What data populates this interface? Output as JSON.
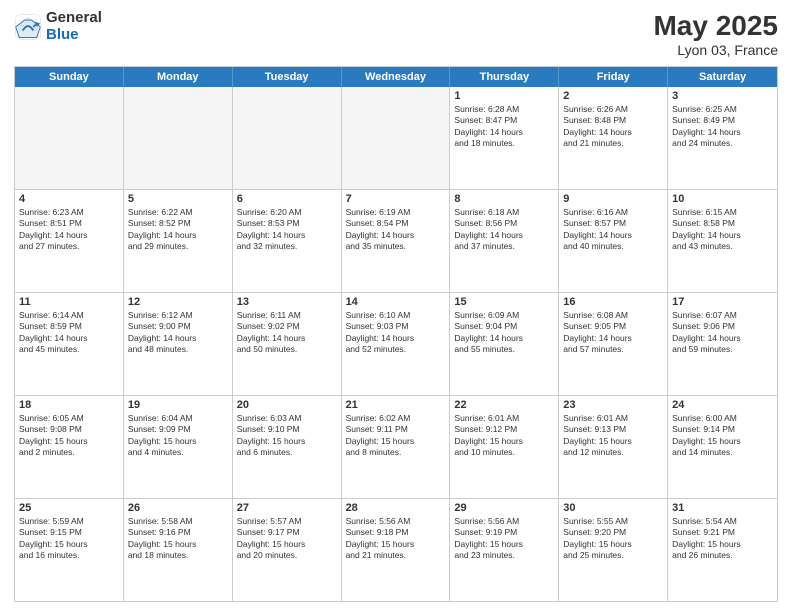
{
  "header": {
    "logo_general": "General",
    "logo_blue": "Blue",
    "title": "May 2025",
    "location": "Lyon 03, France"
  },
  "weekdays": [
    "Sunday",
    "Monday",
    "Tuesday",
    "Wednesday",
    "Thursday",
    "Friday",
    "Saturday"
  ],
  "rows": [
    [
      {
        "day": "",
        "info": ""
      },
      {
        "day": "",
        "info": ""
      },
      {
        "day": "",
        "info": ""
      },
      {
        "day": "",
        "info": ""
      },
      {
        "day": "1",
        "info": "Sunrise: 6:28 AM\nSunset: 8:47 PM\nDaylight: 14 hours\nand 18 minutes."
      },
      {
        "day": "2",
        "info": "Sunrise: 6:26 AM\nSunset: 8:48 PM\nDaylight: 14 hours\nand 21 minutes."
      },
      {
        "day": "3",
        "info": "Sunrise: 6:25 AM\nSunset: 8:49 PM\nDaylight: 14 hours\nand 24 minutes."
      }
    ],
    [
      {
        "day": "4",
        "info": "Sunrise: 6:23 AM\nSunset: 8:51 PM\nDaylight: 14 hours\nand 27 minutes."
      },
      {
        "day": "5",
        "info": "Sunrise: 6:22 AM\nSunset: 8:52 PM\nDaylight: 14 hours\nand 29 minutes."
      },
      {
        "day": "6",
        "info": "Sunrise: 6:20 AM\nSunset: 8:53 PM\nDaylight: 14 hours\nand 32 minutes."
      },
      {
        "day": "7",
        "info": "Sunrise: 6:19 AM\nSunset: 8:54 PM\nDaylight: 14 hours\nand 35 minutes."
      },
      {
        "day": "8",
        "info": "Sunrise: 6:18 AM\nSunset: 8:56 PM\nDaylight: 14 hours\nand 37 minutes."
      },
      {
        "day": "9",
        "info": "Sunrise: 6:16 AM\nSunset: 8:57 PM\nDaylight: 14 hours\nand 40 minutes."
      },
      {
        "day": "10",
        "info": "Sunrise: 6:15 AM\nSunset: 8:58 PM\nDaylight: 14 hours\nand 43 minutes."
      }
    ],
    [
      {
        "day": "11",
        "info": "Sunrise: 6:14 AM\nSunset: 8:59 PM\nDaylight: 14 hours\nand 45 minutes."
      },
      {
        "day": "12",
        "info": "Sunrise: 6:12 AM\nSunset: 9:00 PM\nDaylight: 14 hours\nand 48 minutes."
      },
      {
        "day": "13",
        "info": "Sunrise: 6:11 AM\nSunset: 9:02 PM\nDaylight: 14 hours\nand 50 minutes."
      },
      {
        "day": "14",
        "info": "Sunrise: 6:10 AM\nSunset: 9:03 PM\nDaylight: 14 hours\nand 52 minutes."
      },
      {
        "day": "15",
        "info": "Sunrise: 6:09 AM\nSunset: 9:04 PM\nDaylight: 14 hours\nand 55 minutes."
      },
      {
        "day": "16",
        "info": "Sunrise: 6:08 AM\nSunset: 9:05 PM\nDaylight: 14 hours\nand 57 minutes."
      },
      {
        "day": "17",
        "info": "Sunrise: 6:07 AM\nSunset: 9:06 PM\nDaylight: 14 hours\nand 59 minutes."
      }
    ],
    [
      {
        "day": "18",
        "info": "Sunrise: 6:05 AM\nSunset: 9:08 PM\nDaylight: 15 hours\nand 2 minutes."
      },
      {
        "day": "19",
        "info": "Sunrise: 6:04 AM\nSunset: 9:09 PM\nDaylight: 15 hours\nand 4 minutes."
      },
      {
        "day": "20",
        "info": "Sunrise: 6:03 AM\nSunset: 9:10 PM\nDaylight: 15 hours\nand 6 minutes."
      },
      {
        "day": "21",
        "info": "Sunrise: 6:02 AM\nSunset: 9:11 PM\nDaylight: 15 hours\nand 8 minutes."
      },
      {
        "day": "22",
        "info": "Sunrise: 6:01 AM\nSunset: 9:12 PM\nDaylight: 15 hours\nand 10 minutes."
      },
      {
        "day": "23",
        "info": "Sunrise: 6:01 AM\nSunset: 9:13 PM\nDaylight: 15 hours\nand 12 minutes."
      },
      {
        "day": "24",
        "info": "Sunrise: 6:00 AM\nSunset: 9:14 PM\nDaylight: 15 hours\nand 14 minutes."
      }
    ],
    [
      {
        "day": "25",
        "info": "Sunrise: 5:59 AM\nSunset: 9:15 PM\nDaylight: 15 hours\nand 16 minutes."
      },
      {
        "day": "26",
        "info": "Sunrise: 5:58 AM\nSunset: 9:16 PM\nDaylight: 15 hours\nand 18 minutes."
      },
      {
        "day": "27",
        "info": "Sunrise: 5:57 AM\nSunset: 9:17 PM\nDaylight: 15 hours\nand 20 minutes."
      },
      {
        "day": "28",
        "info": "Sunrise: 5:56 AM\nSunset: 9:18 PM\nDaylight: 15 hours\nand 21 minutes."
      },
      {
        "day": "29",
        "info": "Sunrise: 5:56 AM\nSunset: 9:19 PM\nDaylight: 15 hours\nand 23 minutes."
      },
      {
        "day": "30",
        "info": "Sunrise: 5:55 AM\nSunset: 9:20 PM\nDaylight: 15 hours\nand 25 minutes."
      },
      {
        "day": "31",
        "info": "Sunrise: 5:54 AM\nSunset: 9:21 PM\nDaylight: 15 hours\nand 26 minutes."
      }
    ]
  ]
}
